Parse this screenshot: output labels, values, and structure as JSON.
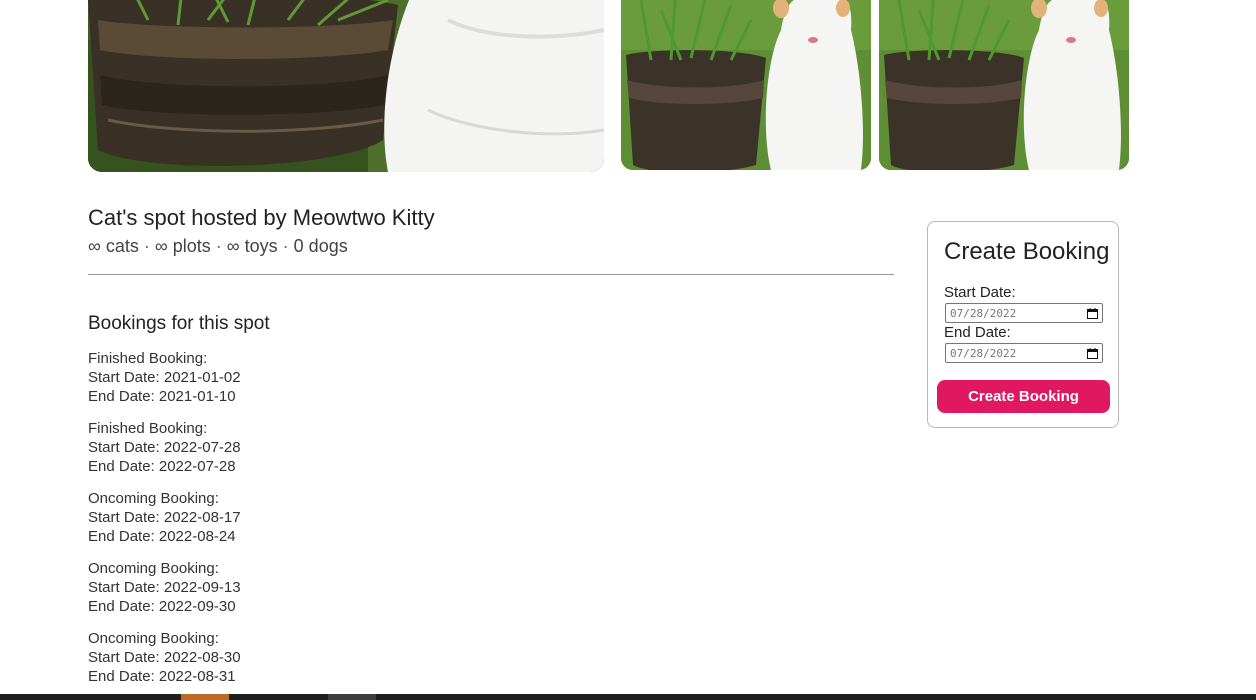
{
  "gallery": {
    "images": [
      {
        "subject": "white cat sitting beside potted cat grass",
        "view": "close-up"
      },
      {
        "subject": "white cat sitting beside potted cat grass",
        "view": "full"
      },
      {
        "subject": "white cat sitting beside potted cat grass",
        "view": "full"
      }
    ]
  },
  "listing": {
    "title": "Cat's spot hosted by Meowtwo Kitty",
    "stats": [
      "∞ cats",
      "∞ plots",
      "∞ toys",
      "0 dogs"
    ],
    "separator": "·"
  },
  "bookings": {
    "heading": "Bookings for this spot",
    "items": [
      {
        "status": "Finished Booking:",
        "start": "Start Date: 2021-01-02",
        "end": "End Date: 2021-01-10"
      },
      {
        "status": "Finished Booking:",
        "start": "Start Date: 2022-07-28",
        "end": "End Date: 2022-07-28"
      },
      {
        "status": "Oncoming Booking:",
        "start": "Start Date: 2022-08-17",
        "end": "End Date: 2022-08-24"
      },
      {
        "status": "Oncoming Booking:",
        "start": "Start Date: 2022-09-13",
        "end": "End Date: 2022-09-30"
      },
      {
        "status": "Oncoming Booking:",
        "start": "Start Date: 2022-08-30",
        "end": "End Date: 2022-08-31"
      }
    ]
  },
  "booking_form": {
    "title": "Create Booking",
    "start_label": "Start Date:",
    "start_value": "07/28/2022",
    "end_label": "End Date:",
    "end_value": "07/28/2022",
    "calendar_icon": "calendar-icon",
    "submit_label": "Create Booking"
  },
  "colors": {
    "accent": "#e0185f",
    "taskbar": "#1f1f1f"
  }
}
